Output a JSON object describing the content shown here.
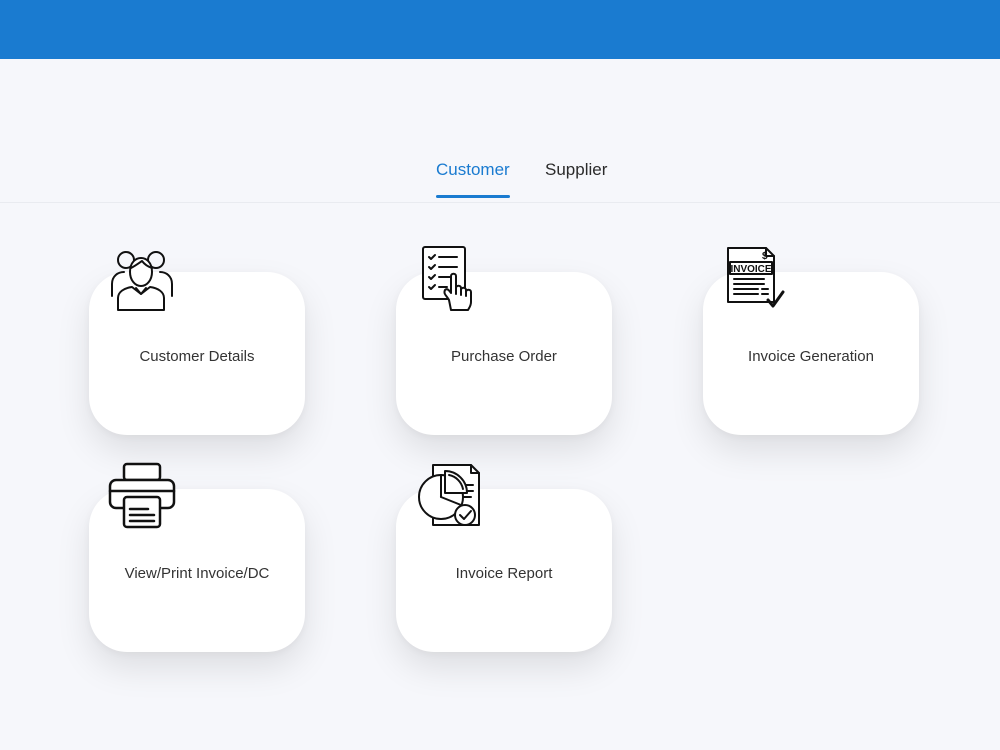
{
  "tabs": [
    {
      "label": "Customer",
      "active": true
    },
    {
      "label": "Supplier",
      "active": false
    }
  ],
  "cards": [
    {
      "label": "Customer Details",
      "icon": "customers-icon"
    },
    {
      "label": "Purchase Order",
      "icon": "purchase-order-icon"
    },
    {
      "label": "Invoice Generation",
      "icon": "invoice-icon"
    },
    {
      "label": "View/Print Invoice/DC",
      "icon": "printer-icon"
    },
    {
      "label": "Invoice Report",
      "icon": "report-icon"
    }
  ],
  "icon_text": {
    "invoice_word": "INVOICE",
    "dollar": "$"
  },
  "colors": {
    "header": "#1a7bd0",
    "accent": "#1a7bd0",
    "background": "#f6f7fb",
    "card": "#ffffff"
  }
}
